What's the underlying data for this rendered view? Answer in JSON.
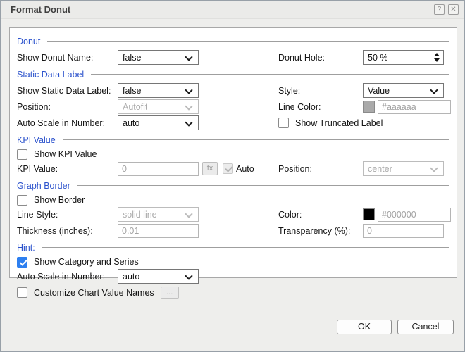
{
  "titlebar": {
    "title": "Format Donut",
    "help_icon": "?",
    "close_icon": "✕"
  },
  "colors": {
    "section_header_blue": "#2b52cc",
    "checked_checkbox_blue": "#2d7ff0",
    "line_color_swatch": "#aaaaaa",
    "border_color_swatch": "#000000",
    "dialog_background": "#eeeeec"
  },
  "donut": {
    "title": "Donut",
    "show_name_label": "Show Donut Name:",
    "show_name_value": "false",
    "hole_label": "Donut Hole:",
    "hole_value": "50 %"
  },
  "static_data_label": {
    "title": "Static Data Label",
    "show_label": "Show Static Data Label:",
    "show_value": "false",
    "style_label": "Style:",
    "style_value": "Value",
    "position_label": "Position:",
    "position_value": "Autofit",
    "line_color_label": "Line Color:",
    "line_color_value": "#aaaaaa",
    "auto_scale_label": "Auto Scale in Number:",
    "auto_scale_value": "auto",
    "truncated_label": "Show Truncated Label",
    "truncated_checked": false
  },
  "kpi_value": {
    "title": "KPI Value",
    "show_label": "Show KPI Value",
    "show_checked": false,
    "value_label": "KPI Value:",
    "value": "0",
    "fx_label": "fx",
    "auto_label": "Auto",
    "auto_checked": true,
    "position_label": "Position:",
    "position_value": "center"
  },
  "graph_border": {
    "title": "Graph Border",
    "show_label": "Show Border",
    "show_checked": false,
    "line_style_label": "Line Style:",
    "line_style_value": "solid line",
    "color_label": "Color:",
    "color_value": "#000000",
    "thickness_label": "Thickness (inches):",
    "thickness_value": "0.01",
    "transparency_label": "Transparency (%):",
    "transparency_value": "0"
  },
  "hint": {
    "title": "Hint:",
    "show_category_label": "Show Category and Series",
    "show_category_checked": true,
    "auto_scale_label": "Auto Scale in Number:",
    "auto_scale_value": "auto",
    "customize_label": "Customize Chart Value Names",
    "customize_checked": false,
    "ellipsis_label": "..."
  },
  "footer": {
    "ok_label": "OK",
    "cancel_label": "Cancel"
  }
}
